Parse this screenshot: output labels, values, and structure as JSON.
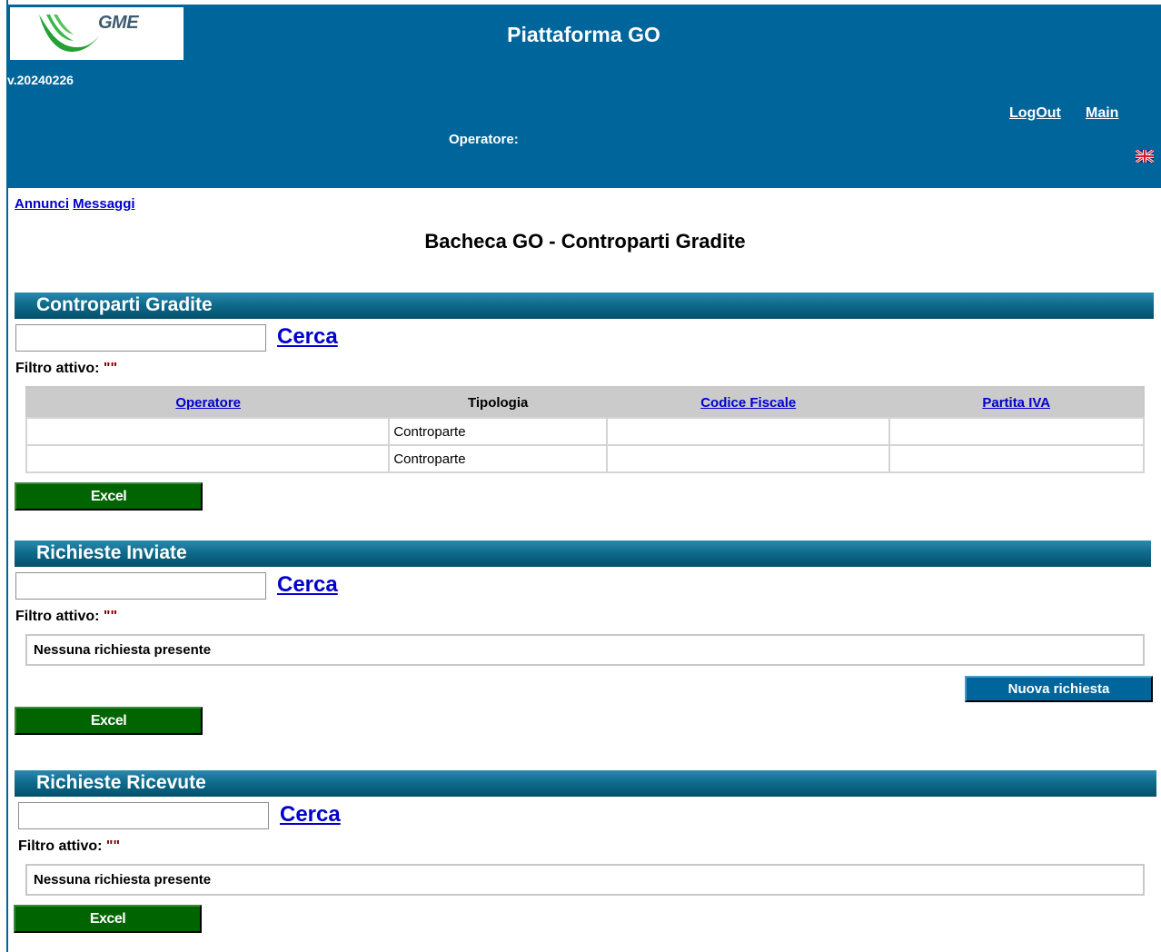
{
  "header": {
    "logo_text": "GME",
    "app_title": "Piattaforma GO",
    "version": "v.20240226",
    "logout": "LogOut",
    "main": "Main",
    "operator_label": "Operatore:",
    "flag_icon": "uk-flag-icon",
    "colors": {
      "header_bg": "#00659a",
      "excel_btn": "#006400",
      "link": "#0000cc"
    }
  },
  "nav": {
    "annunci": "Annunci",
    "messaggi": "Messaggi"
  },
  "page_title": "Bacheca GO - Controparti Gradite",
  "sections": [
    {
      "title": "Controparti Gradite",
      "search_label": "Cerca",
      "search_value": "",
      "filter_label": "Filtro attivo:",
      "filter_value": "\"\"",
      "table": {
        "headers": [
          "Operatore",
          "Tipologia",
          "Codice Fiscale",
          "Partita IVA"
        ],
        "rows": [
          [
            "",
            "Controparte",
            "",
            ""
          ],
          [
            "",
            "Controparte",
            "",
            ""
          ]
        ]
      },
      "excel_label": "Excel"
    },
    {
      "title": "Richieste Inviate",
      "search_label": "Cerca",
      "search_value": "",
      "filter_label": "Filtro attivo:",
      "filter_value": "\"\"",
      "empty_message": "Nessuna richiesta presente",
      "new_request_label": "Nuova richiesta",
      "excel_label": "Excel"
    },
    {
      "title": "Richieste Ricevute",
      "search_label": "Cerca",
      "search_value": "",
      "filter_label": "Filtro attivo:",
      "filter_value": "\"\"",
      "empty_message": "Nessuna richiesta presente",
      "excel_label": "Excel"
    }
  ]
}
